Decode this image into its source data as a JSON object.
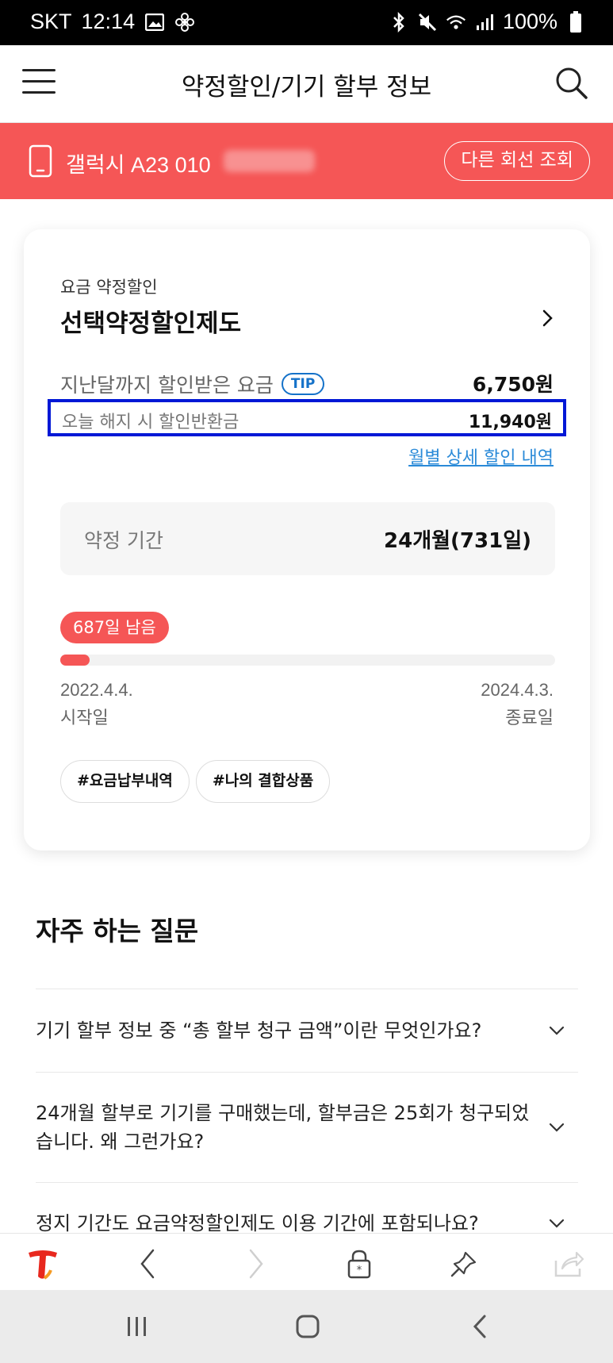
{
  "status_bar": {
    "carrier": "SKT",
    "time": "12:14",
    "battery": "100%"
  },
  "header": {
    "title": "약정할인/기기 할부 정보"
  },
  "banner": {
    "line_name": "갤럭시 A23  010",
    "other_line_button": "다른 회선 조회"
  },
  "card": {
    "category": "요금 약정할인",
    "plan_name": "선택약정할인제도",
    "discount_received_label": "지난달까지 할인받은 요금",
    "tip_badge": "TIP",
    "discount_received_value": "6,750원",
    "penalty_label": "오늘 해지 시 할인반환금",
    "penalty_value": "11,940원",
    "monthly_detail_link": "월별 상세 할인 내역",
    "period_label": "약정 기간",
    "period_value": "24개월(731일)",
    "remaining_badge": "687일 남음",
    "progress_fraction": 0.06,
    "start_date": "2022.4.4.",
    "start_label": "시작일",
    "end_date": "2024.4.3.",
    "end_label": "종료일",
    "tags": [
      "#요금납부내역",
      "#나의 결합상품"
    ]
  },
  "faq": {
    "title": "자주 하는 질문",
    "items": [
      {
        "q": "기기 할부 정보 중 “총 할부 청구 금액”이란 무엇인가요?"
      },
      {
        "q": "24개월 할부로 기기를 구매했는데, 할부금은 25회가 청구되었습니다. 왜 그런가요?"
      },
      {
        "q": "정지 기간도 요금약정할인제도 이용 기간에 포함되나요?"
      }
    ]
  },
  "colors": {
    "accent": "#f55656",
    "highlight_box": "#0018d6",
    "link": "#2a8ad8",
    "tip": "#1572c9"
  }
}
